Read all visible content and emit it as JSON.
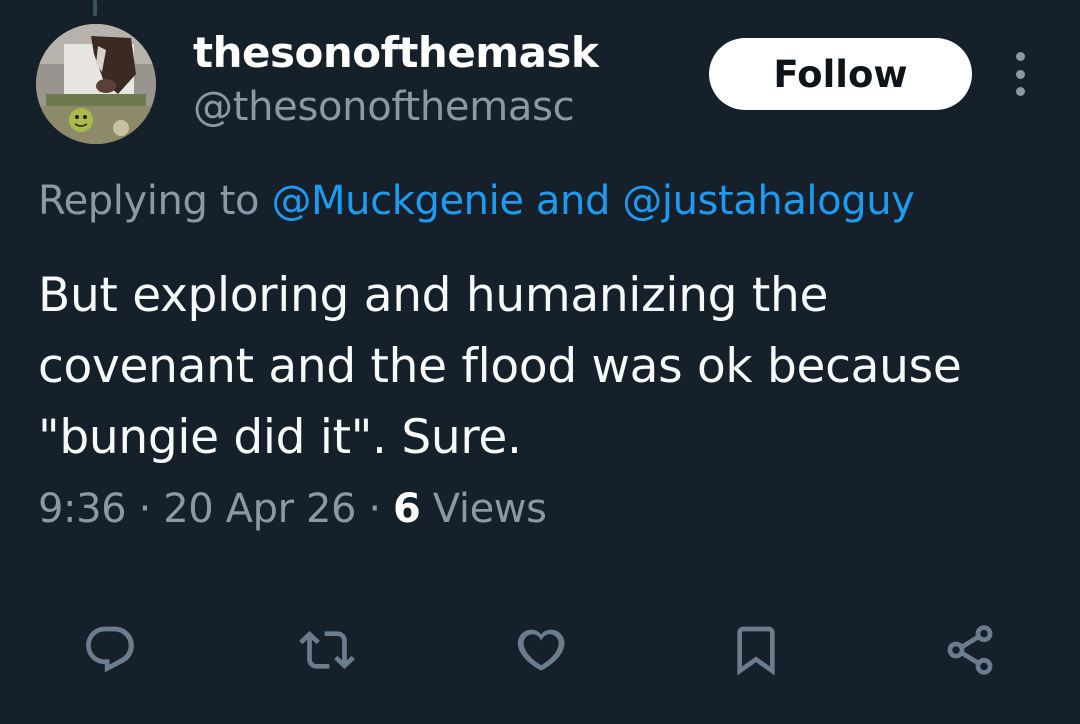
{
  "author": {
    "display_name": "thesonofthemask",
    "handle": "@thesonofthemasc"
  },
  "follow_label": "Follow",
  "reply_context": {
    "prefix": "Replying to",
    "mention_1": "@Muckgenie",
    "conjunction": "and",
    "mention_2": "@justahaloguy"
  },
  "tweet": {
    "lines": [
      "But exploring and humanizing the",
      "covenant and the flood was ok because",
      "\"bungie did it\". Sure."
    ]
  },
  "meta": {
    "time": "9:36",
    "separator": "·",
    "date": "20 Apr 26",
    "views_count": "6",
    "views_label": "Views"
  },
  "icons": {
    "reply": "reply-icon",
    "retweet": "retweet-icon",
    "like": "like-icon",
    "bookmark": "bookmark-icon",
    "share": "share-icon",
    "more": "more-icon"
  },
  "colors": {
    "background": "#15202b",
    "link": "#1d9bf0",
    "secondary_text": "#8b98a5",
    "icon": "#6b7d8c"
  }
}
